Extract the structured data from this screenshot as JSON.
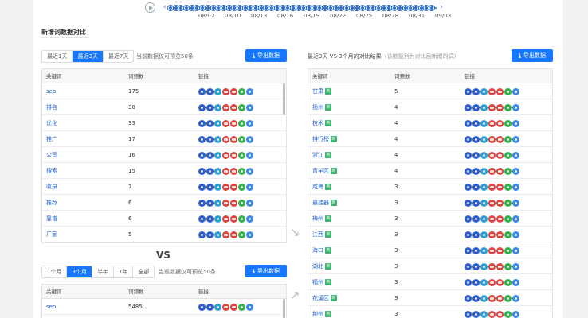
{
  "timeline": {
    "dates": [
      "08/07",
      "08/10",
      "08/13",
      "08/16",
      "08/19",
      "08/22",
      "08/25",
      "08/28",
      "08/31",
      "09/03"
    ],
    "prev_icon": "chevron-left-icon",
    "next_icon": "chevron-right-icon",
    "play_icon": "play-icon"
  },
  "section": {
    "title": "新增词数据对比"
  },
  "left_top": {
    "tabs": [
      {
        "label": "最近1天"
      },
      {
        "label": "最近3天"
      },
      {
        "label": "最近7天"
      }
    ],
    "active_tab": 1,
    "hint": "当前数据仅可预览50条",
    "export_label": "导出数据",
    "columns": [
      "关键词",
      "词频数",
      "链接"
    ],
    "rows": [
      {
        "kw": "seo",
        "count": "175"
      },
      {
        "kw": "排名",
        "count": "38"
      },
      {
        "kw": "优化",
        "count": "33"
      },
      {
        "kw": "推广",
        "count": "17"
      },
      {
        "kw": "公司",
        "count": "16"
      },
      {
        "kw": "搜索",
        "count": "15"
      },
      {
        "kw": "收录",
        "count": "7"
      },
      {
        "kw": "推荐",
        "count": "6"
      },
      {
        "kw": "靠谱",
        "count": "6"
      },
      {
        "kw": "厂家",
        "count": "5"
      }
    ]
  },
  "vs_label": "VS",
  "left_bottom": {
    "tabs": [
      {
        "label": "1个月"
      },
      {
        "label": "3个月"
      },
      {
        "label": "半年"
      },
      {
        "label": "1年"
      },
      {
        "label": "全部"
      }
    ],
    "active_tab": 1,
    "hint": "当前数据仅可预览50条",
    "export_label": "导出数据",
    "columns": [
      "关键词",
      "词频数",
      "链接"
    ],
    "rows": [
      {
        "kw": "seo",
        "count": "5485"
      }
    ]
  },
  "right": {
    "title": "最近3天 VS 3个月的对比结果",
    "subtitle": "（该数据列为对比后新增的词）",
    "export_label": "导出数据",
    "new_tag": "新",
    "columns": [
      "关键词",
      "词频数",
      "链接"
    ],
    "rows": [
      {
        "kw": "甘肃",
        "count": "5"
      },
      {
        "kw": "扬州",
        "count": "4"
      },
      {
        "kw": "技术",
        "count": "4"
      },
      {
        "kw": "排行榜",
        "count": "4"
      },
      {
        "kw": "浙江",
        "count": "4"
      },
      {
        "kw": "青羊区",
        "count": "4"
      },
      {
        "kw": "咸海",
        "count": "3"
      },
      {
        "kw": "悬挂器",
        "count": "3"
      },
      {
        "kw": "梅州",
        "count": "3"
      },
      {
        "kw": "江西",
        "count": "3"
      },
      {
        "kw": "海口",
        "count": "3"
      },
      {
        "kw": "湖北",
        "count": "3"
      },
      {
        "kw": "福州",
        "count": "3"
      },
      {
        "kw": "花溪区",
        "count": "3"
      },
      {
        "kw": "荆州",
        "count": "3"
      }
    ]
  },
  "link_icons": [
    "baidu-icon",
    "360-icon",
    "sogou-icon",
    "mobile-baidu-icon",
    "shenma-icon",
    "wechat-icon",
    "toutiao-icon"
  ]
}
